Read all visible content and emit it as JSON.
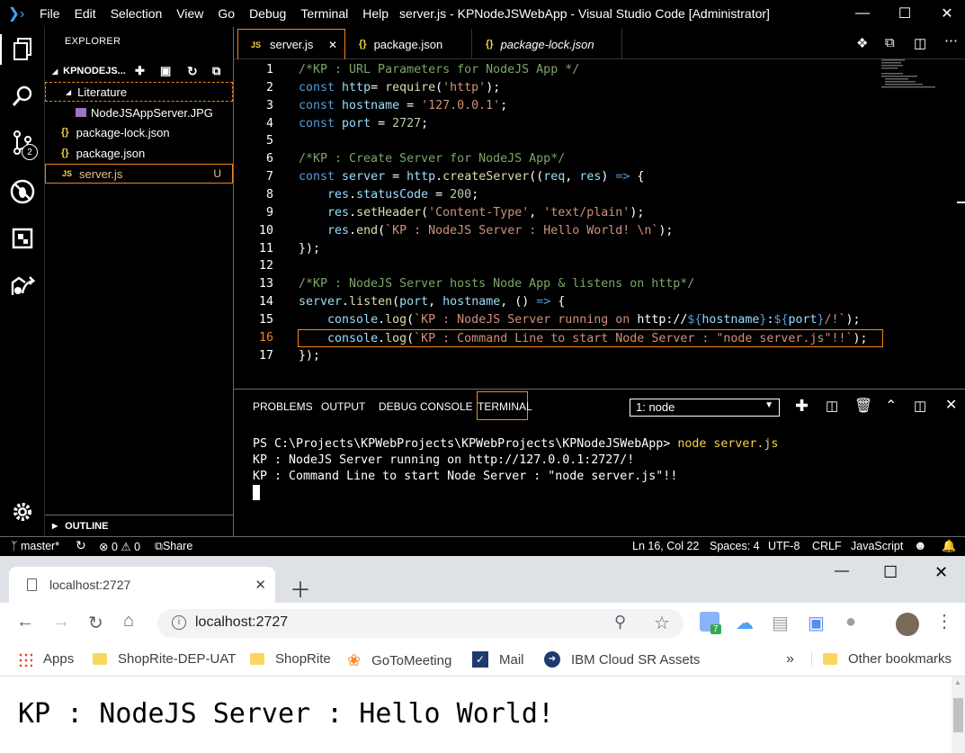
{
  "vscode": {
    "menu": [
      "File",
      "Edit",
      "Selection",
      "View",
      "Go",
      "Debug",
      "Terminal",
      "Help"
    ],
    "window_title": "server.js - KPNodeJSWebApp - Visual Studio Code [Administrator]",
    "scm_badge": "2",
    "explorer": {
      "title": "EXPLORER",
      "project": "KPNODEJS...",
      "items": [
        {
          "label": "Literature"
        },
        {
          "label": "NodeJSAppServer.JPG"
        },
        {
          "label": "package-lock.json"
        },
        {
          "label": "package.json"
        },
        {
          "label": "server.js",
          "status": "U"
        }
      ],
      "outline": "OUTLINE"
    },
    "tabs": [
      {
        "label": "server.js",
        "icon": "JS"
      },
      {
        "label": "package.json",
        "icon": "{}"
      },
      {
        "label": "package-lock.json",
        "icon": "{}"
      }
    ],
    "line_numbers": [
      "1",
      "2",
      "3",
      "4",
      "5",
      "6",
      "7",
      "8",
      "9",
      "10",
      "11",
      "12",
      "13",
      "14",
      "15",
      "16",
      "17"
    ],
    "code": [
      [
        [
          "cm",
          "/*KP : URL Parameters for NodeJS App */"
        ]
      ],
      [
        [
          "kw",
          "const "
        ],
        [
          "var",
          "http"
        ],
        [
          "",
          "= "
        ],
        [
          "fn",
          "require"
        ],
        [
          "",
          "("
        ],
        [
          "str",
          "'http'"
        ],
        [
          "",
          ");"
        ]
      ],
      [
        [
          "kw",
          "const "
        ],
        [
          "var",
          "hostname"
        ],
        [
          "",
          " = "
        ],
        [
          "str",
          "'127.0.0.1'"
        ],
        [
          "",
          ";"
        ]
      ],
      [
        [
          "kw",
          "const "
        ],
        [
          "var",
          "port"
        ],
        [
          "",
          " = "
        ],
        [
          "num",
          "2727"
        ],
        [
          "",
          ";"
        ]
      ],
      [],
      [
        [
          "cm",
          "/*KP : Create Server for NodeJS App*/"
        ]
      ],
      [
        [
          "kw",
          "const "
        ],
        [
          "var",
          "server"
        ],
        [
          "",
          " = "
        ],
        [
          "var",
          "http"
        ],
        [
          "",
          "."
        ],
        [
          "fn",
          "createServer"
        ],
        [
          "",
          "(("
        ],
        [
          "var",
          "req"
        ],
        [
          "",
          ", "
        ],
        [
          "var",
          "res"
        ],
        [
          "",
          ") "
        ],
        [
          "kw",
          "=>"
        ],
        [
          "",
          " {"
        ]
      ],
      [
        [
          "",
          "    "
        ],
        [
          "var",
          "res"
        ],
        [
          "",
          "."
        ],
        [
          "var",
          "statusCode"
        ],
        [
          "",
          " = "
        ],
        [
          "num",
          "200"
        ],
        [
          "",
          ";"
        ]
      ],
      [
        [
          "",
          "    "
        ],
        [
          "var",
          "res"
        ],
        [
          "",
          "."
        ],
        [
          "fn",
          "setHeader"
        ],
        [
          "",
          "("
        ],
        [
          "str",
          "'Content-Type'"
        ],
        [
          "",
          ", "
        ],
        [
          "str",
          "'text/plain'"
        ],
        [
          "",
          ");"
        ]
      ],
      [
        [
          "",
          "    "
        ],
        [
          "var",
          "res"
        ],
        [
          "",
          "."
        ],
        [
          "fn",
          "end"
        ],
        [
          "",
          "("
        ],
        [
          "str",
          "`KP : NodeJS Server : Hello World! \\n`"
        ],
        [
          "",
          ");"
        ]
      ],
      [
        [
          "",
          "});"
        ]
      ],
      [],
      [
        [
          "cm",
          "/*KP : NodeJS Server hosts Node App & listens on http*/"
        ]
      ],
      [
        [
          "var",
          "server"
        ],
        [
          "",
          "."
        ],
        [
          "fn",
          "listen"
        ],
        [
          "",
          "("
        ],
        [
          "var",
          "port"
        ],
        [
          "",
          ", "
        ],
        [
          "var",
          "hostname"
        ],
        [
          "",
          ", () "
        ],
        [
          "kw",
          "=>"
        ],
        [
          "",
          " {"
        ]
      ],
      [
        [
          "",
          "    "
        ],
        [
          "var",
          "console"
        ],
        [
          "",
          "."
        ],
        [
          "fn",
          "log"
        ],
        [
          "",
          "("
        ],
        [
          "str",
          "`KP : NodeJS Server running on "
        ],
        [
          "",
          "http://"
        ],
        [
          "kw",
          "${"
        ],
        [
          "var",
          "hostname"
        ],
        [
          "kw",
          "}"
        ],
        [
          "",
          ":"
        ],
        [
          "kw",
          "${"
        ],
        [
          "var",
          "port"
        ],
        [
          "kw",
          "}"
        ],
        [
          "str",
          "/!`"
        ],
        [
          "",
          ");"
        ]
      ],
      [
        [
          "",
          "    "
        ],
        [
          "var",
          "console"
        ],
        [
          "",
          "."
        ],
        [
          "fn",
          "log"
        ],
        [
          "",
          "("
        ],
        [
          "str",
          "`KP : Command Line to start Node Server : \"node server.js\"!!`"
        ],
        [
          "",
          ");"
        ]
      ],
      [
        [
          "",
          "});"
        ]
      ]
    ],
    "panel": {
      "tabs": [
        "PROBLEMS",
        "OUTPUT",
        "DEBUG CONSOLE",
        "TERMINAL"
      ],
      "terminal_select": "1: node",
      "prompt": "PS C:\\Projects\\KPWebProjects\\KPWebProjects\\KPNodeJSWebApp>",
      "command": "node server.js",
      "output": [
        "KP : NodeJS Server running on http://127.0.0.1:2727/!",
        "KP : Command Line to start Node Server : \"node server.js\"!!"
      ]
    },
    "status": {
      "branch": "master*",
      "errors": "0",
      "warnings": "0",
      "share": "Share",
      "position": "Ln 16, Col 22",
      "spaces": "Spaces: 4",
      "encoding": "UTF-8",
      "eol": "CRLF",
      "language": "JavaScript"
    }
  },
  "chrome": {
    "tab_title": "localhost:2727",
    "url": "localhost:2727",
    "extension_badge": "7",
    "bookmarks": [
      "Apps",
      "ShopRite-DEP-UAT",
      "ShopRite",
      "GoToMeeting",
      "Mail",
      "IBM Cloud SR Assets"
    ],
    "other_bookmarks": "Other bookmarks",
    "page_text": "KP : NodeJS Server : Hello World!"
  }
}
